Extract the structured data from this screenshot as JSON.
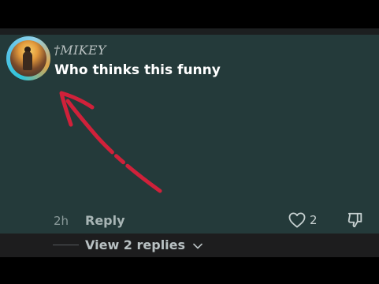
{
  "comment": {
    "username": "†MIKEY",
    "text": "Who thinks this funny",
    "timestamp": "2h",
    "reply_label": "Reply",
    "like_count": "2"
  },
  "replies": {
    "view_label": "View 2 replies"
  },
  "icons": {
    "like": "heart-icon",
    "dislike": "thumbs-down-icon",
    "expand": "chevron-down-icon"
  },
  "colors": {
    "card_background": "#243a3a",
    "annotation_arrow": "#d0213a",
    "avatar_ring": "#2ec4d8"
  }
}
